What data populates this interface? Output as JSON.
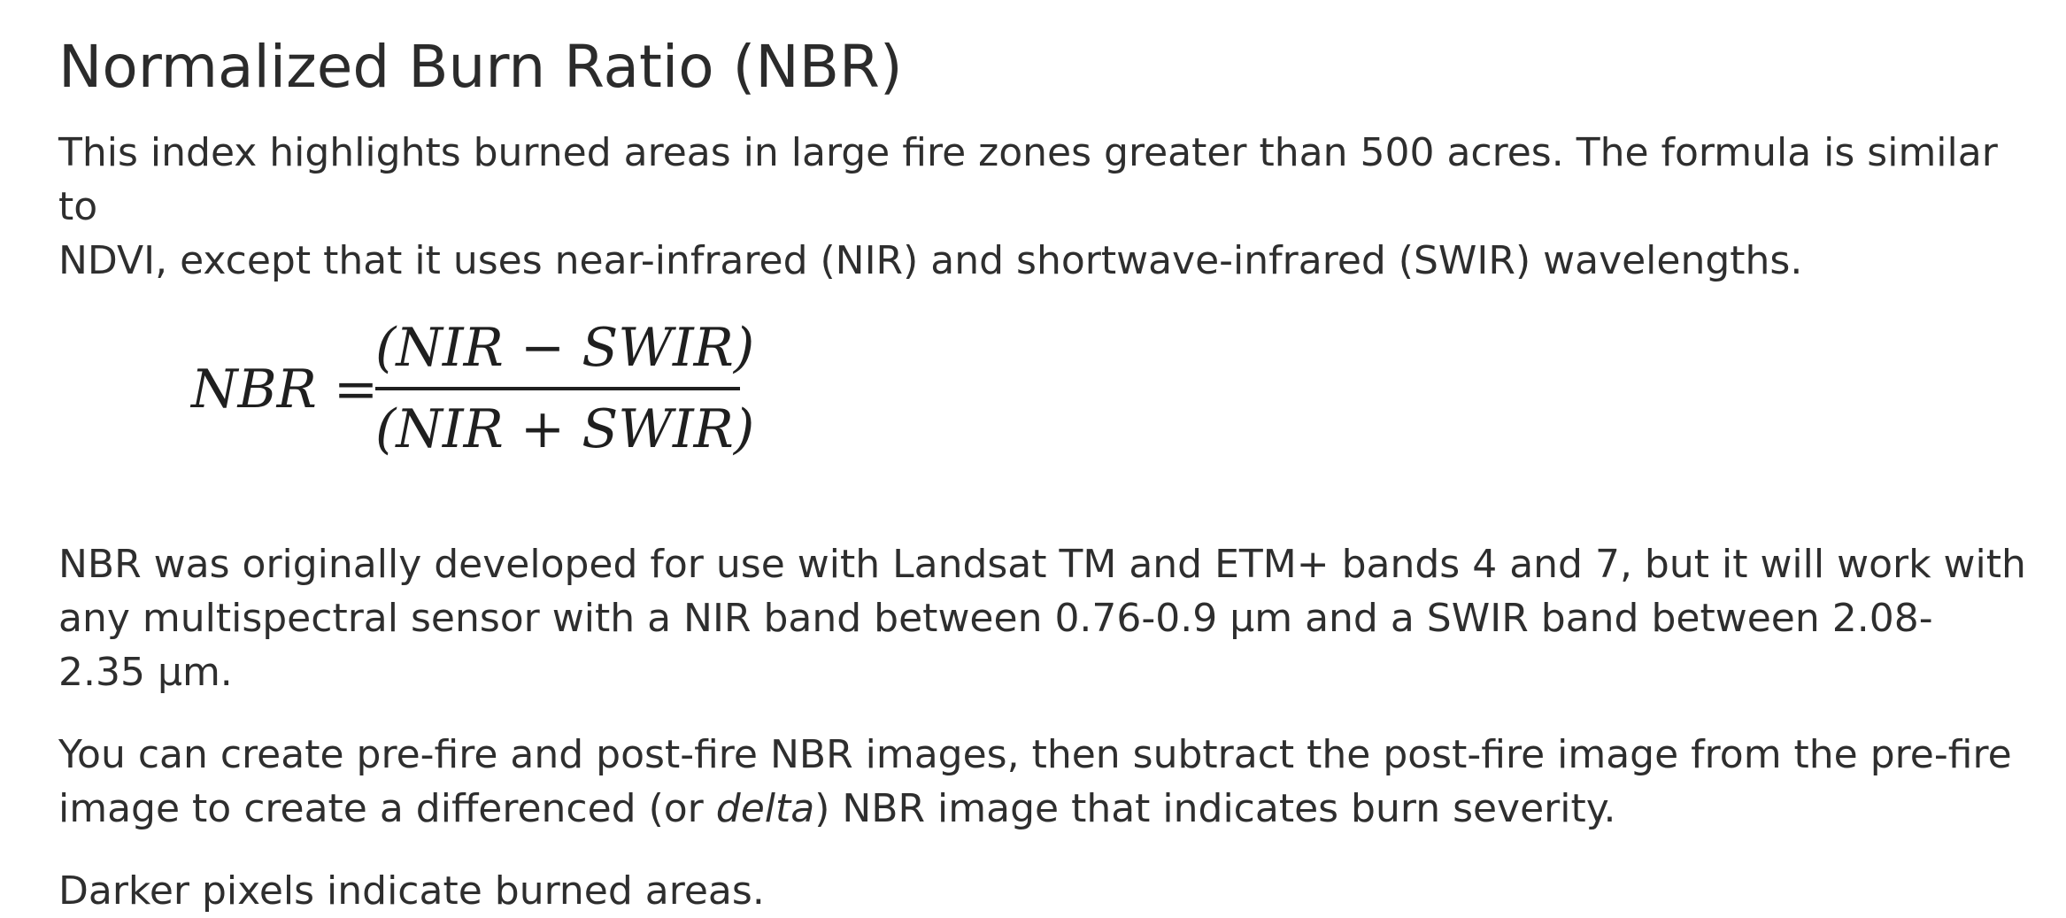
{
  "heading": "Normalized Burn Ratio (NBR)",
  "intro": {
    "line1": "This index highlights burned areas in large fire zones greater than 500 acres. The formula is similar to",
    "line2": "NDVI, except that it uses near-infrared (NIR) and shortwave-infrared (SWIR) wavelengths."
  },
  "formula": {
    "lhs": "NBR =",
    "numerator": "(NIR − SWIR)",
    "denominator": "(NIR + SWIR)"
  },
  "para_sensor": {
    "line1": "NBR was originally developed for use with Landsat TM and ETM+ bands 4 and 7, but it will work with",
    "line2": "any multispectral sensor with a NIR band between 0.76-0.9 µm and a SWIR band between 2.08-",
    "line3": "2.35 µm."
  },
  "para_delta": {
    "line1": "You can create pre-fire and post-fire NBR images, then subtract the post-fire image from the pre-fire",
    "line2_before": "image to create a differenced (or ",
    "line2_emphasis": "delta",
    "line2_after": ") NBR image that indicates burn severity."
  },
  "para_darker": "Darker pixels indicate burned areas."
}
